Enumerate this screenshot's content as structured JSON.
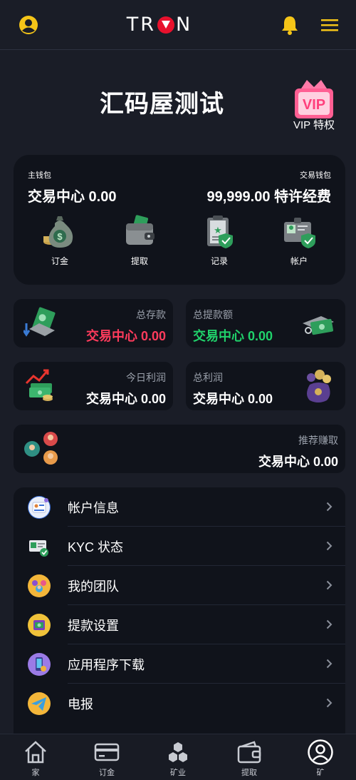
{
  "header": {
    "logo_text_left": "T",
    "logo_text_mid": "R",
    "logo_text_right": "N",
    "icons": [
      "user-circle-icon",
      "bell-icon",
      "hamburger-menu-icon"
    ]
  },
  "title": {
    "page_title": "汇码屋测试",
    "vip_badge_text": "VIP",
    "vip_label": "VIP 特权"
  },
  "wallet": {
    "main_label": "主钱包",
    "main_value": "交易中心 0.00",
    "trade_label": "交易钱包",
    "trade_value": "99,999.00 特许经费",
    "actions": [
      {
        "label": "订金",
        "icon": "money-bag-icon"
      },
      {
        "label": "提取",
        "icon": "wallet-icon"
      },
      {
        "label": "记录",
        "icon": "clipboard-icon"
      },
      {
        "label": "帐户",
        "icon": "id-card-icon"
      }
    ]
  },
  "stats": {
    "total_deposit": {
      "label": "总存款",
      "value": "交易中心 0.00"
    },
    "total_withdrawal": {
      "label": "总提款额",
      "value": "交易中心 0.00"
    },
    "today_profit": {
      "label": "今日利润",
      "value": "交易中心 0.00"
    },
    "total_profit": {
      "label": "总利润",
      "value": "交易中心 0.00"
    },
    "referral": {
      "label": "推荐赚取",
      "value": "交易中心 0.00"
    }
  },
  "menu": [
    {
      "label": "帐户信息",
      "icon": "account-info-icon"
    },
    {
      "label": "KYC 状态",
      "icon": "kyc-icon"
    },
    {
      "label": "我的团队",
      "icon": "team-icon"
    },
    {
      "label": "提款设置",
      "icon": "withdraw-settings-icon"
    },
    {
      "label": "应用程序下载",
      "icon": "app-download-icon"
    },
    {
      "label": "电报",
      "icon": "telegram-icon"
    }
  ],
  "tabbar": [
    {
      "label": "家",
      "icon": "home-icon"
    },
    {
      "label": "订金",
      "icon": "card-icon"
    },
    {
      "label": "矿业",
      "icon": "cubes-icon"
    },
    {
      "label": "提取",
      "icon": "wallet-icon"
    },
    {
      "label": "矿",
      "icon": "user-circle-icon"
    }
  ],
  "colors": {
    "background": "#1a1d27",
    "card": "#10131b",
    "accent_yellow": "#f5c518",
    "deposit_red": "#ff3b5c",
    "withdraw_green": "#20d26b",
    "muted_text": "#9aa0ab",
    "tron_red": "#e8112d"
  }
}
